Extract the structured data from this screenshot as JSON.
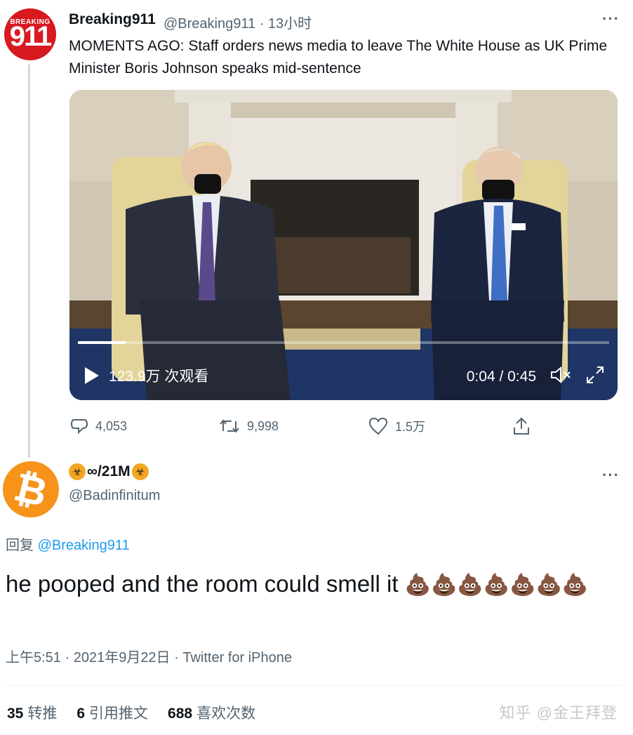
{
  "tweet": {
    "avatar_text_top": "BREAKING",
    "avatar_text_big": "911",
    "author_name": "Breaking911",
    "author_handle": "@Breaking911 · 13小时",
    "more_icon": "···",
    "text": "MOMENTS AGO: Staff orders news media to leave The White House as UK Prime Minister Boris Johnson speaks mid-sentence",
    "video": {
      "views": "123.9万 次观看",
      "time": "0:04 / 0:45",
      "progress_fraction": 0.09
    },
    "actions": {
      "reply_count": "4,053",
      "retweet_count": "9,998",
      "like_count": "1.5万"
    }
  },
  "reply": {
    "author_name": "∞/21M",
    "author_handle": "@Badinfinitum",
    "reply_prefix": "回复",
    "reply_to": "@Breaking911",
    "text": "he pooped and the room could smell it",
    "emojis": "💩💩💩💩💩💩💩",
    "meta": "上午5:51 · 2021年9月22日 · Twitter for iPhone",
    "stats": {
      "retweets_num": "35",
      "retweets_label": "转推",
      "quotes_num": "6",
      "quotes_label": "引用推文",
      "likes_num": "688",
      "likes_label": "喜欢次数"
    }
  },
  "watermark": "知乎 @金王拜登",
  "colors": {
    "link": "#1d9bf0",
    "secondary": "#536471",
    "brand": "#d71920",
    "bitcoin": "#f7931a"
  }
}
